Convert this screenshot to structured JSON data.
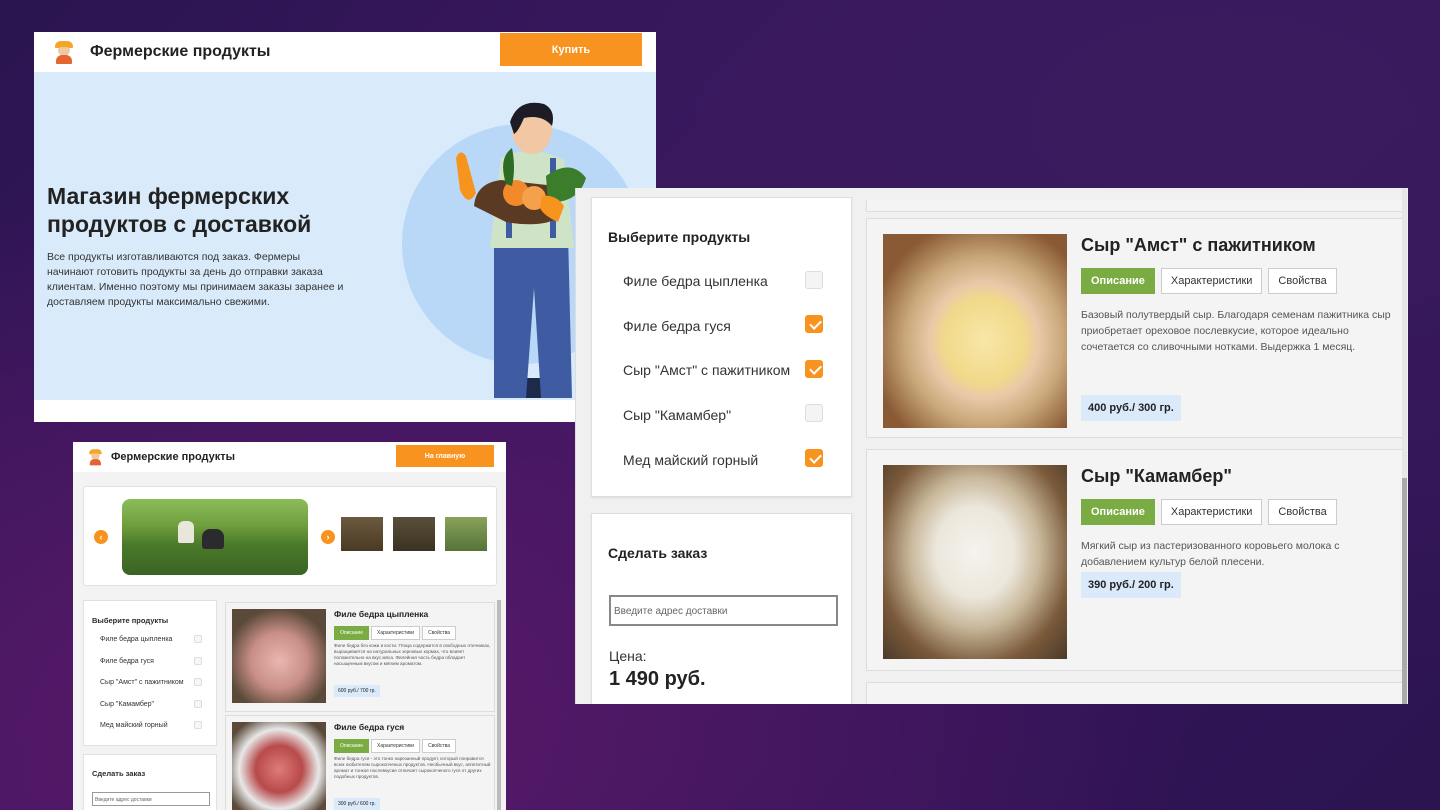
{
  "landing": {
    "brand": "Фермерские продукты",
    "buy_button": "Купить",
    "hero_title": "Магазин фермерских продуктов с доставкой",
    "hero_text": "Все продукты изготавливаются под заказ. Фермеры начинают готовить продукты за день до отправки заказа клиентам. Именно поэтому мы принимаем заказы заранее и доставляем продукты максимально свежими."
  },
  "catalog_small": {
    "brand": "Фермерские продукты",
    "home_button": "На главную",
    "prev": "‹",
    "next": "›",
    "choose_title": "Выберите продукты",
    "items": [
      "Филе бедра цыпленка",
      "Филе бедра гуся",
      "Сыр \"Амст\" с пажитником",
      "Сыр \"Камамбер\"",
      "Мед майский горный"
    ],
    "order_title": "Сделать заказ",
    "address_placeholder": "Введите адрес доставки",
    "products": [
      {
        "title": "Филе бедра цыпленка",
        "tabs": [
          "Описание",
          "Характеристики",
          "Свойства"
        ],
        "desc": "Филе бедра без кожи и кости. Птица содержится в свободных птичниках, выращивается на натуральных зерновых кормах, что влияет положительно на вкус мяса. Филейная часть бедра обладает насыщенным вкусом и мягким ароматом.",
        "price": "600 руб./ 700 гр."
      },
      {
        "title": "Филе бедра гуся",
        "tabs": [
          "Описание",
          "Характеристики",
          "Свойства"
        ],
        "desc": "Филе бедра гуся - это тонко нарезанный продукт, который понравится всем любителям сырокопченых продуктов. Необычный вкус, аппетитный аромат и тонкое послевкусие отличает сырокопченого гуся от других подобных продуктов.",
        "price": "300 руб./ 600 гр."
      }
    ]
  },
  "catalog_zoom": {
    "choose_title": "Выберите продукты",
    "items": [
      {
        "label": "Филе бедра цыпленка",
        "checked": false
      },
      {
        "label": "Филе бедра гуся",
        "checked": true
      },
      {
        "label": "Сыр \"Амст\" с пажитником",
        "checked": true
      },
      {
        "label": "Сыр \"Камамбер\"",
        "checked": false
      },
      {
        "label": "Мед майский горный",
        "checked": true
      }
    ],
    "order_title": "Сделать заказ",
    "address_placeholder": "Введите адрес доставки",
    "price_label": "Цена:",
    "price_value": "1 490 руб.",
    "products": [
      {
        "title": "Сыр \"Амст\" с пажитником",
        "tabs": [
          "Описание",
          "Характеристики",
          "Свойства"
        ],
        "desc": "Базовый полутвердый сыр. Благодаря семенам пажитника сыр приобретает ореховое послевкусие, которое идеально сочетается со сливочными нотками. Выдержка 1 месяц.",
        "price": "400 руб./ 300 гр."
      },
      {
        "title": "Сыр \"Камамбер\"",
        "tabs": [
          "Описание",
          "Характеристики",
          "Свойства"
        ],
        "desc": "Мягкий сыр из пастеризованного коровьего молока с добавлением культур белой плесени.",
        "price": "390 руб./ 200 гр."
      }
    ]
  },
  "colors": {
    "accent_orange": "#f7931e",
    "tab_green": "#7bac43",
    "price_badge": "#dbeafb",
    "hero_bg": "#d9ebfb",
    "backdrop": "#2a1550"
  }
}
